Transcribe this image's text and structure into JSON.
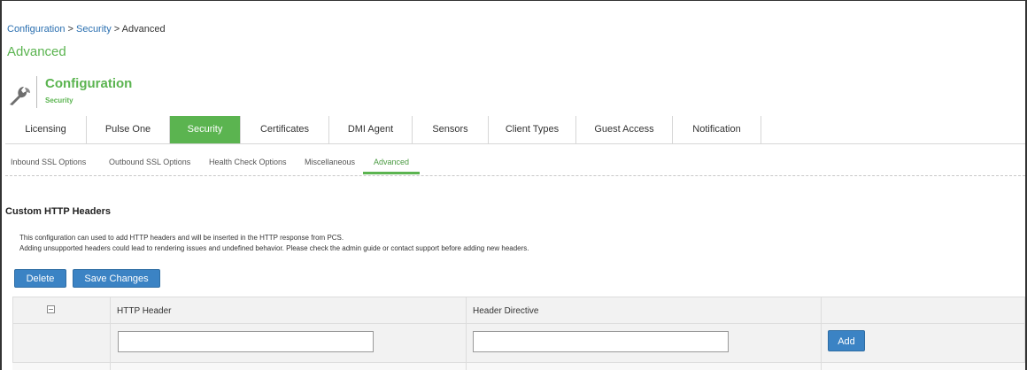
{
  "breadcrumb": {
    "link1": "Configuration",
    "sep1": " > ",
    "link2": "Security",
    "sep2": " > ",
    "current": "Advanced"
  },
  "page_title": "Advanced",
  "section": {
    "title": "Configuration",
    "subtitle": "Security",
    "icon": "wrench-icon"
  },
  "tabs": [
    {
      "label": "Licensing"
    },
    {
      "label": "Pulse One"
    },
    {
      "label": "Security",
      "active": true
    },
    {
      "label": "Certificates"
    },
    {
      "label": "DMI Agent"
    },
    {
      "label": "Sensors"
    },
    {
      "label": "Client Types"
    },
    {
      "label": "Guest Access"
    },
    {
      "label": "Notification"
    }
  ],
  "subtabs": [
    {
      "label": "Inbound SSL Options"
    },
    {
      "label": "Outbound SSL Options"
    },
    {
      "label": "Health Check Options"
    },
    {
      "label": "Miscellaneous"
    },
    {
      "label": "Advanced",
      "active": true
    }
  ],
  "content": {
    "title": "Custom HTTP Headers",
    "desc1": "This configuration can used to add HTTP headers and will be inserted in the HTTP response from PCS.",
    "desc2": "Adding unsupported headers could lead to rendering issues and undefined behavior. Please check the admin guide or contact support before adding new headers."
  },
  "buttons": {
    "delete": "Delete",
    "save": "Save Changes",
    "add": "Add"
  },
  "table": {
    "col_header": "HTTP Header",
    "col_directive": "Header Directive",
    "header_input_value": "",
    "directive_input_value": ""
  },
  "colors": {
    "accent_green": "#5bb450",
    "button_blue": "#3b83c4",
    "link_blue": "#2a6fb0"
  }
}
